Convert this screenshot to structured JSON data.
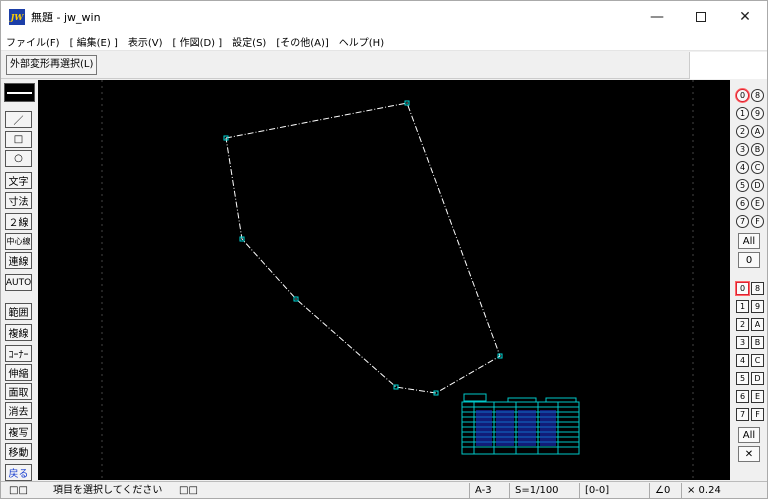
{
  "window": {
    "title": "無題 - jw_win",
    "icon_text": "JW"
  },
  "menu": [
    "ファイル(F)",
    "[ 編集(E) ]",
    "表示(V)",
    "[ 作図(D) ]",
    "設定(S)",
    "[その他(A)]",
    "ヘルプ(H)"
  ],
  "toolbar": {
    "button_label": "外部変形再選択(L)"
  },
  "left_tools": [
    "／",
    "□",
    "○",
    "文字",
    "寸法",
    "２線",
    "中心線",
    "連線",
    "AUTO",
    "範囲",
    "複線",
    "ｺｰﾅｰ",
    "伸縮",
    "面取",
    "消去",
    "複写",
    "移動",
    "戻る"
  ],
  "right_layer_groups": {
    "circles_left": [
      "0",
      "1",
      "2",
      "3",
      "4",
      "5",
      "6",
      "7"
    ],
    "circles_right": [
      "8",
      "9",
      "A",
      "B",
      "C",
      "D",
      "E",
      "F"
    ],
    "all_label": "All",
    "zero_label": "0"
  },
  "right_layers": {
    "squares_left": [
      "0",
      "1",
      "2",
      "3",
      "4",
      "5",
      "6",
      "7"
    ],
    "squares_right": [
      "8",
      "9",
      "A",
      "B",
      "C",
      "D",
      "E",
      "F"
    ],
    "all_label": "All",
    "x_label": "✕"
  },
  "status": {
    "left_icons": "□□",
    "message": "項目を選択してください",
    "mid_icons": "□□",
    "paper": "A-3",
    "scale": "S=1/100",
    "layer": "[0-0]",
    "angle": "∠0",
    "zoom": "× 0.24"
  },
  "colors": {
    "canvas": "#000000",
    "polyline": "#ffffff",
    "vertex": "#00d8d8",
    "table": "#00c8c8",
    "table_fill": "#1c30c8"
  }
}
